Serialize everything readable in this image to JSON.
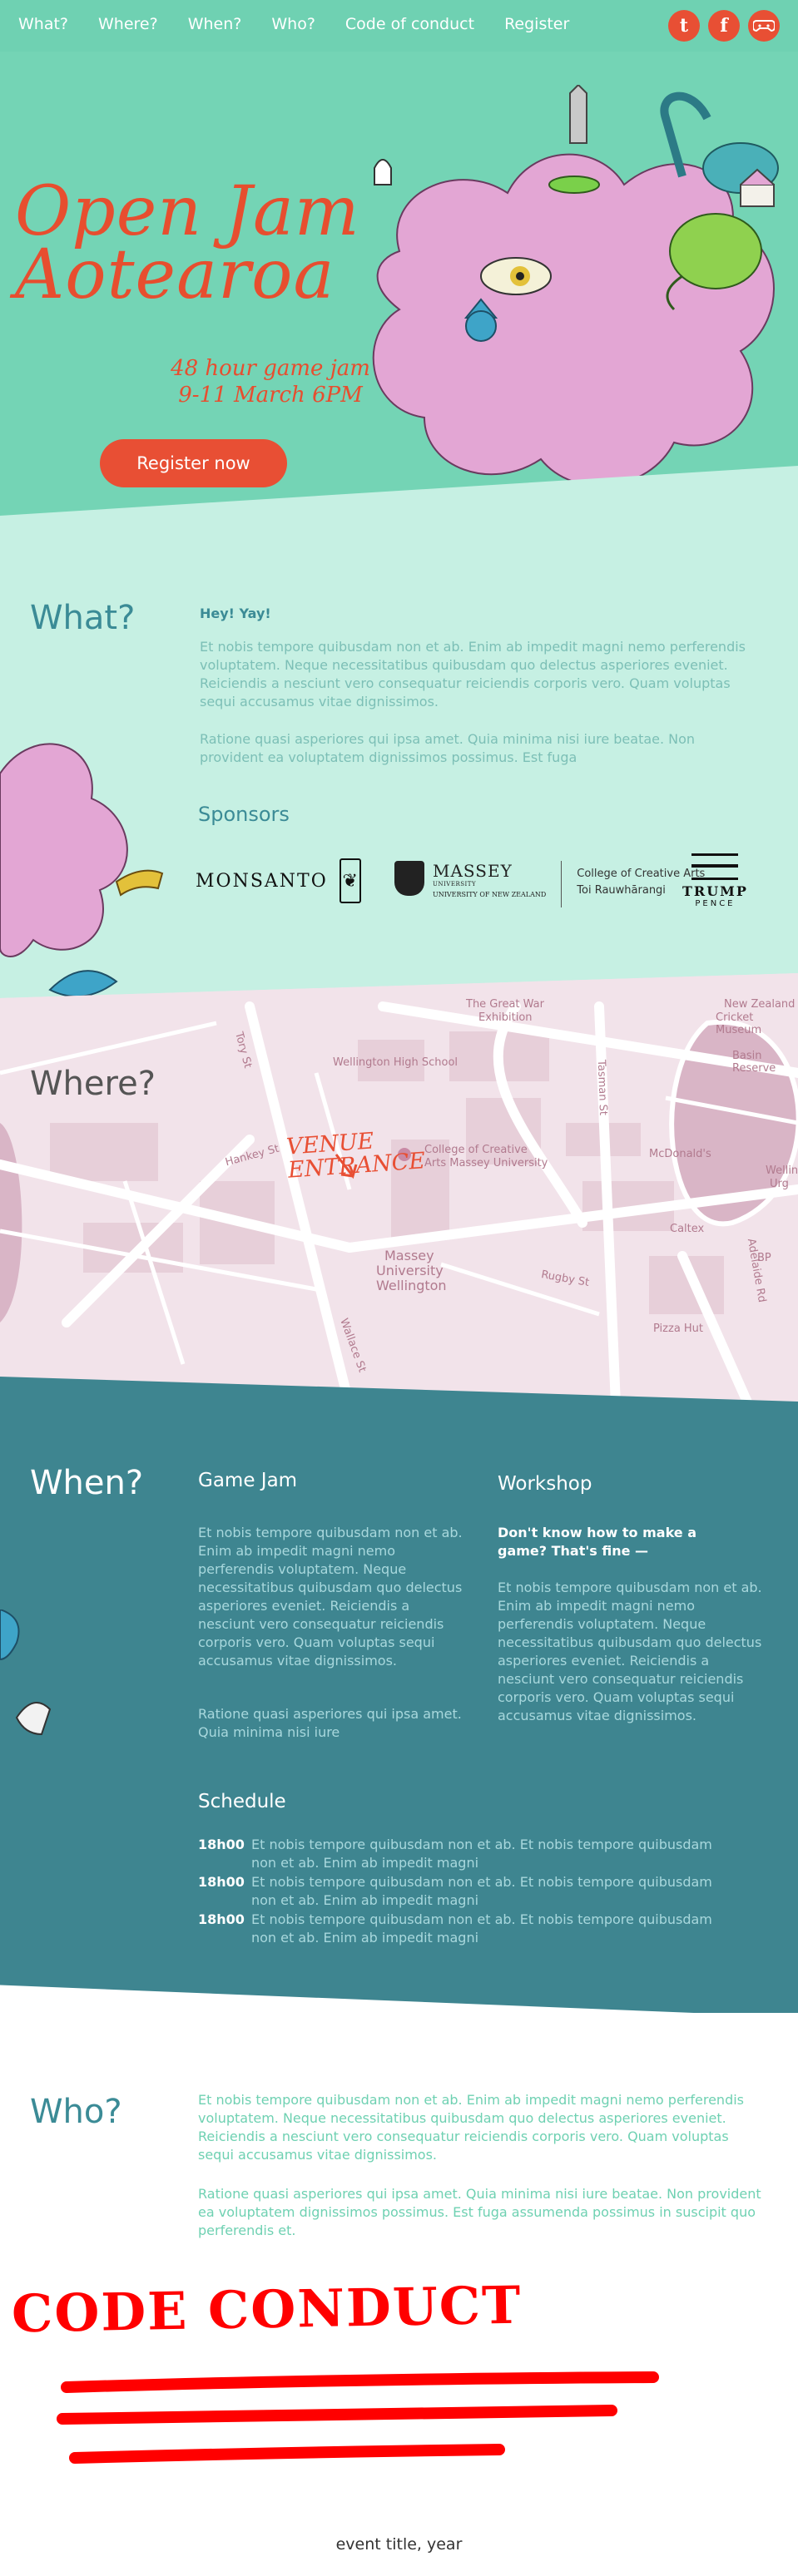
{
  "nav": {
    "items": [
      "What?",
      "Where?",
      "When?",
      "Who?",
      "Code of conduct",
      "Register"
    ],
    "social": [
      {
        "icon": "tumblr-icon",
        "glyph": "t"
      },
      {
        "icon": "facebook-icon",
        "glyph": "f"
      },
      {
        "icon": "gamepad-icon",
        "glyph": "⊙"
      }
    ]
  },
  "hero": {
    "title_line1": "Open Jam",
    "title_line2": "Aotearoa",
    "subtitle_line1": "48 hour game jam",
    "subtitle_line2": "9-11 March  6PM",
    "register_label": "Register now"
  },
  "what": {
    "title": "What?",
    "subtitle": "Hey! Yay!",
    "paragraph1": "Et nobis tempore quibusdam non et ab. Enim ab impedit magni nemo perferendis voluptatem. Neque necessitatibus quibusdam quo delectus asperiores eveniet. Reiciendis a nesciunt vero consequatur reiciendis corporis vero. Quam voluptas sequi accusamus vitae dignissimos.",
    "paragraph2": "Ratione quasi asperiores qui ipsa amet. Quia minima nisi iure beatae. Non provident ea voluptatem dignissimos possimus. Est fuga",
    "sponsors_title": "Sponsors",
    "sponsors": {
      "monsanto": "MONSANTO",
      "massey_name": "MASSEY",
      "massey_small": "UNIVERSITY",
      "massey_nz": "UNIVERSITY OF NEW ZEALAND",
      "massey_college_line1": "College of Creative Arts",
      "massey_college_line2": "Toi Rauwhārangi",
      "trump_name": "TRUMP",
      "trump_sub": "PENCE"
    }
  },
  "where": {
    "title": "Where?",
    "venue_line1": "VENUE",
    "venue_line2": "ENTRANCE",
    "map_labels": {
      "great_war": "The Great War",
      "exhibition": "Exhibition",
      "wellington_high": "Wellington High School",
      "college1": "College of Creative",
      "college2": "Arts Massey University",
      "massey1": "Massey",
      "massey2": "University",
      "massey3": "Wellington",
      "mcdonalds": "McDonald's",
      "caltex": "Caltex",
      "bp": "BP",
      "pizza_hut": "Pizza Hut",
      "new_zealand": "New Zealand",
      "cricket_museum": "Cricket Museum",
      "basin_reserve": "Basin Reserve",
      "wellington_urg1": "Wellin",
      "wellington_urg2": "Urg",
      "adelaide_rd": "Adelaide Rd",
      "tasman_st": "Tasman St",
      "wallace_st": "Wallace St",
      "rugby_st": "Rugby St",
      "hankey_st": "Hankey St",
      "tory_st": "Tory St"
    }
  },
  "when": {
    "title": "When?",
    "game_jam_title": "Game Jam",
    "game_jam_p1": "Et nobis tempore quibusdam non et ab. Enim ab impedit magni nemo perferendis voluptatem. Neque necessitatibus quibusdam quo delectus asperiores eveniet. Reiciendis a nesciunt vero consequatur reiciendis corporis vero. Quam voluptas sequi accusamus vitae dignissimos.",
    "game_jam_p2": "Ratione quasi asperiores qui ipsa amet. Quia minima nisi iure",
    "workshop_title": "Workshop",
    "workshop_strong": "Don't know how to make a game? That's fine —",
    "workshop_p": "Et nobis tempore quibusdam non et ab. Enim ab impedit magni nemo perferendis voluptatem. Neque necessitatibus quibusdam quo delectus asperiores eveniet. Reiciendis a nesciunt vero consequatur reiciendis corporis vero. Quam voluptas sequi accusamus vitae dignissimos.",
    "schedule_title": "Schedule",
    "schedule": [
      {
        "time": "18h00",
        "text": "Et nobis tempore quibusdam non et ab. Et nobis tempore quibusdam non et ab. Enim ab impedit magni"
      },
      {
        "time": "18h00",
        "text": "Et nobis tempore quibusdam non et ab. Et nobis tempore quibusdam non et ab. Enim ab impedit magni"
      },
      {
        "time": "18h00",
        "text": "Et nobis tempore quibusdam non et ab. Et nobis tempore quibusdam non et ab. Enim ab impedit magni"
      }
    ]
  },
  "who": {
    "title": "Who?",
    "paragraph1": "Et nobis tempore quibusdam non et ab. Enim ab impedit magni nemo perferendis voluptatem. Neque necessitatibus quibusdam quo delectus asperiores eveniet. Reiciendis a nesciunt vero consequatur reiciendis corporis vero. Quam voluptas sequi accusamus vitae dignissimos.",
    "paragraph2": "Ratione quasi asperiores qui ipsa amet. Quia minima nisi iure beatae. Non provident ea voluptatem dignissimos possimus. Est fuga assumenda possimus in suscipit quo perferendis et."
  },
  "coc": {
    "title": "CODE CONDUCT"
  },
  "footer": {
    "text": "event title, year"
  },
  "colors": {
    "nav_bg": "#6fd1b2",
    "hero_bg": "#74d4b5",
    "accent": "#e84f34",
    "what_bg": "#c6f0e3",
    "when_bg": "#3e8590",
    "map_bg": "#f2e3ea"
  }
}
